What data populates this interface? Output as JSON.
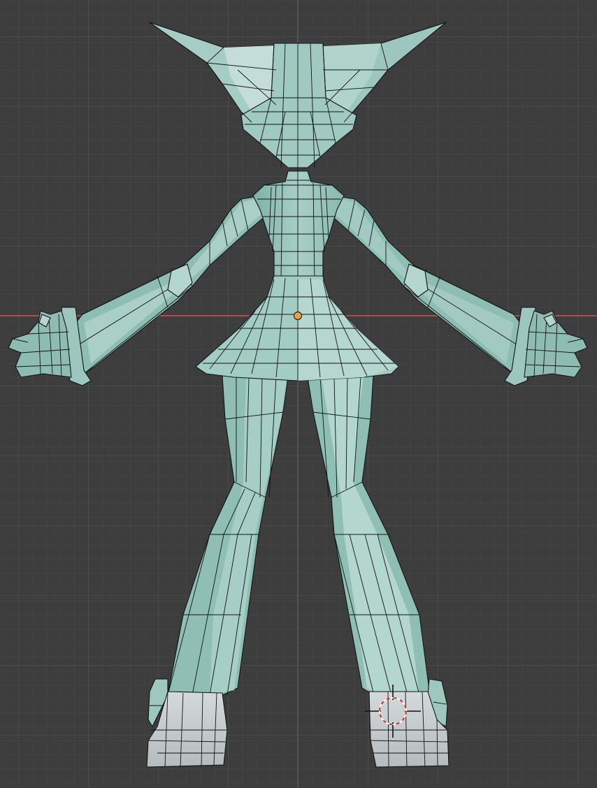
{
  "app": "3D viewport",
  "view": {
    "mode": "object",
    "shading": "solid",
    "grid": true,
    "x_axis_visible": true
  },
  "object": {
    "name": "",
    "type": "mesh",
    "selected": true,
    "origin_visible": true
  },
  "cursor_3d": {
    "visible": true
  },
  "colors": {
    "background": "#3d3d3d",
    "grid_minor": "#474747",
    "grid_major": "#525252",
    "x_axis": "#b34a55",
    "mesh_body": "#98c6bd",
    "mesh_light": "#b6d6cf",
    "mesh_shadow": "#7fb0a6",
    "mesh_boot": "#c9cfd0",
    "wire": "#101412",
    "origin": "#f0a040",
    "cursor_ring_red": "#d03030",
    "cursor_ring_white": "#ffffff"
  }
}
